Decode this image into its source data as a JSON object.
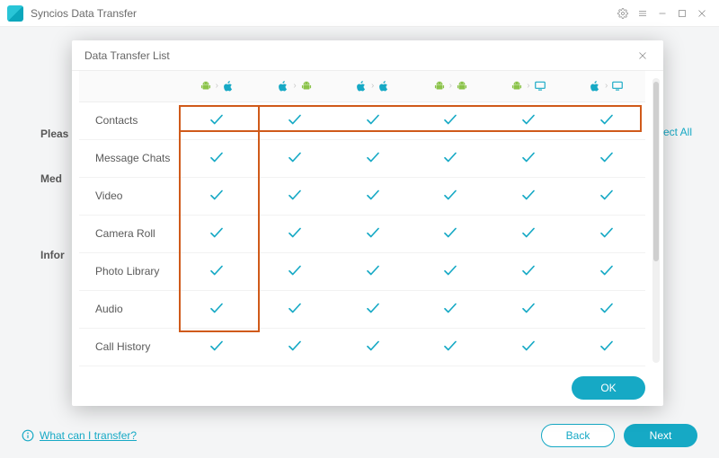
{
  "app": {
    "title": "Syncios Data Transfer"
  },
  "background": {
    "left_labels": [
      "Pleas",
      "Med",
      "Infor"
    ],
    "select_all_partial": "ect All",
    "help_link": "What can I transfer?",
    "back_btn": "Back",
    "next_btn": "Next"
  },
  "modal": {
    "title": "Data Transfer List",
    "ok_btn": "OK",
    "columns": [
      {
        "from": "android",
        "to": "apple"
      },
      {
        "from": "apple",
        "to": "android"
      },
      {
        "from": "apple",
        "to": "apple"
      },
      {
        "from": "android",
        "to": "android"
      },
      {
        "from": "android",
        "to": "computer"
      },
      {
        "from": "apple",
        "to": "computer"
      }
    ],
    "rows": [
      {
        "label": "Contacts",
        "support": [
          true,
          true,
          true,
          true,
          true,
          true
        ]
      },
      {
        "label": "Message Chats",
        "support": [
          true,
          true,
          true,
          true,
          true,
          true
        ]
      },
      {
        "label": "Video",
        "support": [
          true,
          true,
          true,
          true,
          true,
          true
        ]
      },
      {
        "label": "Camera Roll",
        "support": [
          true,
          true,
          true,
          true,
          true,
          true
        ]
      },
      {
        "label": "Photo Library",
        "support": [
          true,
          true,
          true,
          true,
          true,
          true
        ]
      },
      {
        "label": "Audio",
        "support": [
          true,
          true,
          true,
          true,
          true,
          true
        ]
      },
      {
        "label": "Call History",
        "support": [
          true,
          true,
          true,
          true,
          true,
          true
        ]
      }
    ]
  }
}
